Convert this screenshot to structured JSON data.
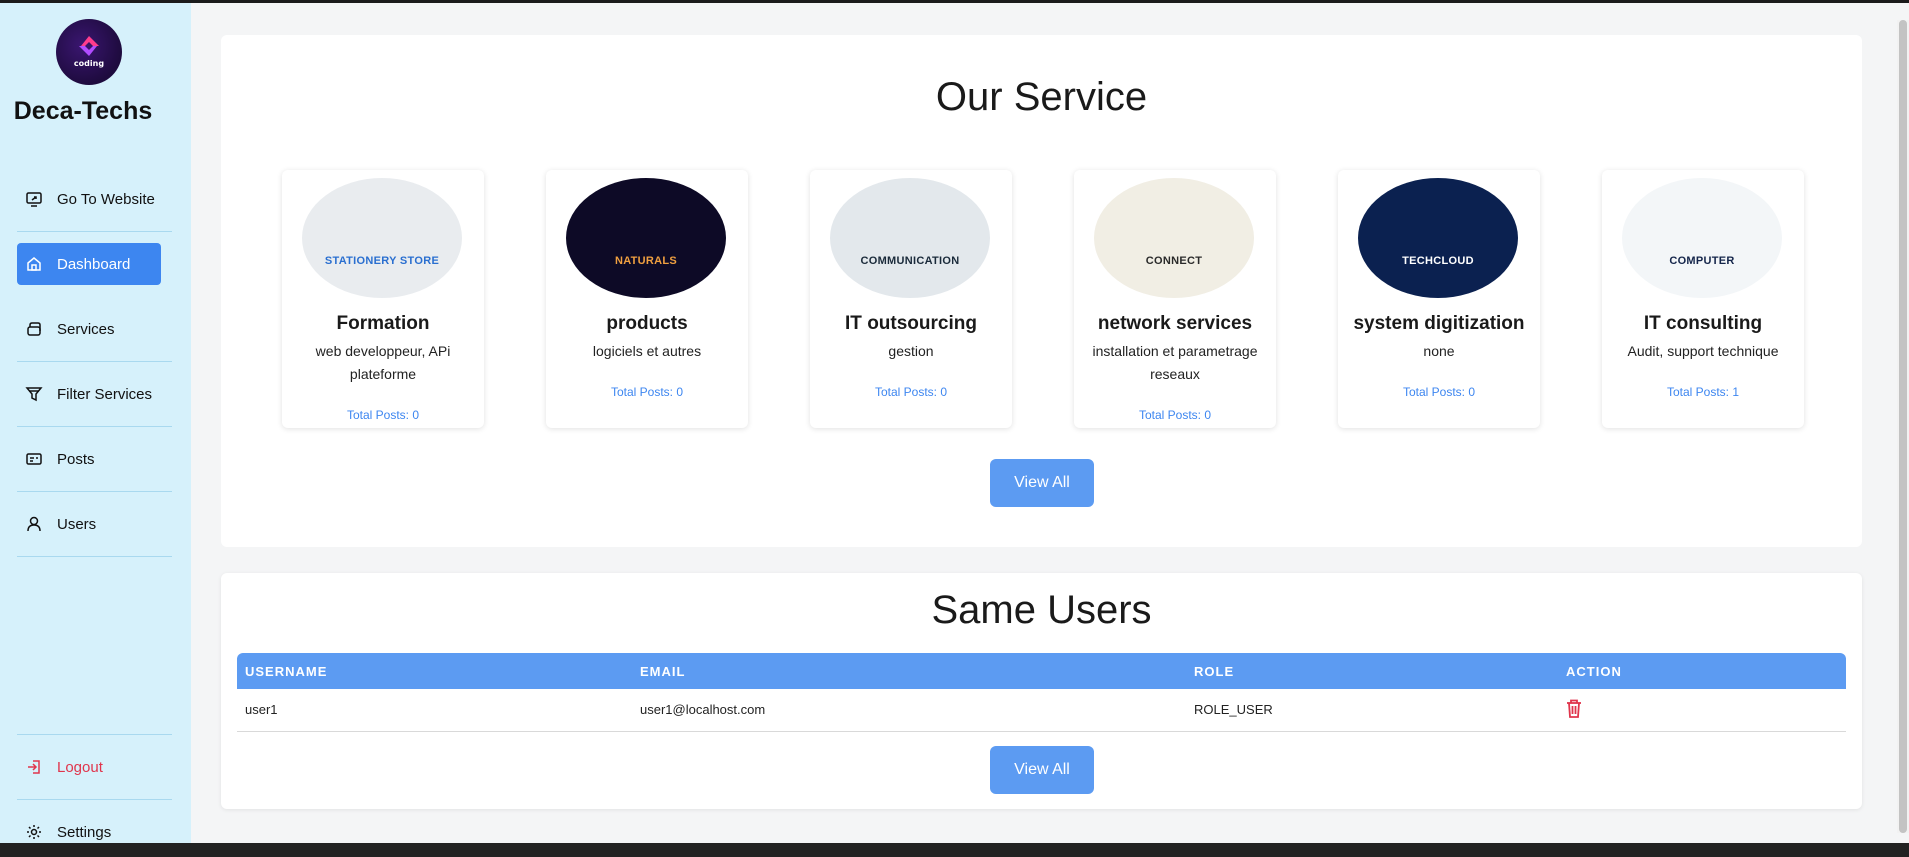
{
  "sidebar": {
    "logo_text": "coding",
    "brand": "Deca-Techs",
    "items": [
      {
        "label": "Go To Website",
        "icon": "external-screen-icon"
      },
      {
        "label": "Dashboard",
        "icon": "home-icon"
      },
      {
        "label": "Services",
        "icon": "stack-icon"
      },
      {
        "label": "Filter Services",
        "icon": "filter-icon"
      },
      {
        "label": "Posts",
        "icon": "card-icon"
      },
      {
        "label": "Users",
        "icon": "user-icon"
      }
    ],
    "logout": {
      "label": "Logout",
      "icon": "logout-icon"
    },
    "settings": {
      "label": "Settings",
      "icon": "gear-icon"
    }
  },
  "services": {
    "title": "Our Service",
    "view_all": "View All",
    "cards": [
      {
        "name": "Formation",
        "desc": "web developpeur, APi plateforme",
        "posts": "Total Posts: 0",
        "image_text": "STATIONERY STORE",
        "image_bg": "#e9ecef",
        "image_fg": "#2a6fd0"
      },
      {
        "name": "products",
        "desc": "logiciels et autres",
        "posts": "Total Posts: 0",
        "image_text": "NATURALS",
        "image_bg": "#0d0a26",
        "image_fg": "#f0a040"
      },
      {
        "name": "IT outsourcing",
        "desc": "gestion",
        "posts": "Total Posts: 0",
        "image_text": "COMMUNICATION",
        "image_bg": "#e3e8ec",
        "image_fg": "#1a2a3a"
      },
      {
        "name": "network services",
        "desc": "installation et parametrage reseaux",
        "posts": "Total Posts: 0",
        "image_text": "CONNECT",
        "image_bg": "#f1eee4",
        "image_fg": "#2a2a2a"
      },
      {
        "name": "system digitization",
        "desc": "none",
        "posts": "Total Posts: 0",
        "image_text": "TECHCLOUD",
        "image_bg": "#0b2150",
        "image_fg": "#ffffff"
      },
      {
        "name": "IT consulting",
        "desc": "Audit, support technique",
        "posts": "Total Posts: 1",
        "image_text": "COMPUTER",
        "image_bg": "#f3f6f8",
        "image_fg": "#14254a"
      }
    ]
  },
  "users": {
    "title": "Same Users",
    "view_all": "View All",
    "columns": [
      "USERNAME",
      "EMAIL",
      "ROLE",
      "ACTION"
    ],
    "rows": [
      {
        "username": "user1",
        "email": "user1@localhost.com",
        "role": "ROLE_USER"
      }
    ]
  },
  "colors": {
    "sidebar_bg": "#d6f1fb",
    "accent": "#3d86f0",
    "button": "#5c9bf2",
    "danger": "#e0354c"
  }
}
